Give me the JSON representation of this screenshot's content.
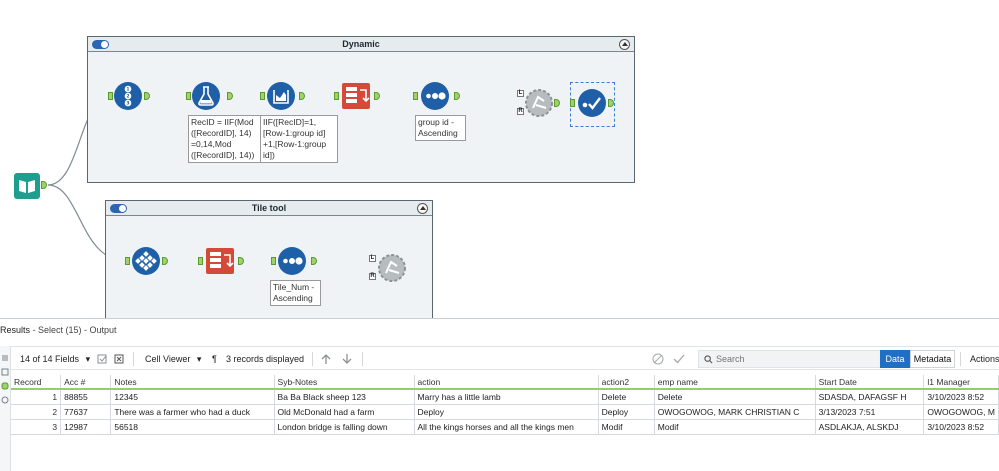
{
  "containers": {
    "dynamic": {
      "title": "Dynamic"
    },
    "tile": {
      "title": "Tile tool"
    }
  },
  "annotations": {
    "formula_recid": "RecID = IIF(Mod\n([RecordID], 14)\n=0,14,Mod\n([RecordID], 14))",
    "multirow": "IIF([RecID]=1,\n[Row-1:group id]\n+1,[Row-1:group\nid])",
    "sort_group": "group id -\nAscending",
    "sort_tile": "Tile_Num -\nAscending"
  },
  "anchors": {
    "join_l": "L",
    "join_r": "R"
  },
  "icons": {
    "input": "book-input-icon",
    "record_id": "record-id-icon",
    "formula": "formula-flask-icon",
    "multirow": "multi-row-formula-icon",
    "crosstab": "cross-tab-icon",
    "sort": "sort-dots-icon",
    "join": "join-gear-icon",
    "select": "select-check-icon",
    "tile": "tile-icon"
  },
  "colors": {
    "tool_blue": "#1f5fa8",
    "tool_teal": "#1e9e8e",
    "tool_red": "#d44a3a",
    "anchor_green": "#9ed36a",
    "accent": "#1f6fc5"
  },
  "results": {
    "label": "Results",
    "context": " - Select (15) - Output",
    "fields_selector": "14 of 14 Fields",
    "cell_viewer": "Cell Viewer",
    "records_displayed": "3 records displayed",
    "search_placeholder": "Search",
    "data_btn": "Data",
    "metadata_btn": "Metadata",
    "actions_btn": "Actions",
    "columns": [
      "Record",
      "Acc #",
      "Notes",
      "Syb-Notes",
      "action",
      "action2",
      "emp name",
      "Start Date",
      "l1 Manager"
    ],
    "rows": [
      [
        "1",
        "88855",
        "12345",
        "Ba Ba Black sheep 123",
        "Marry has a little lamb",
        "Delete",
        "Delete",
        "SDASDA, DAFAGSF H",
        "3/10/2023 8:52"
      ],
      [
        "2",
        "77637",
        "There was a farmer who had a duck",
        "Old McDonald had a farm",
        "Deploy",
        "Deploy",
        "OWOGOWOG, MARK CHRISTIAN C",
        "3/13/2023 7:51",
        "OWOGOWOG, M"
      ],
      [
        "3",
        "12987",
        "56518",
        "London bridge is falling down",
        "All the kings horses and all the kings men",
        "Modif",
        "Modif",
        "ASDLAKJA, ALSKDJ",
        "3/10/2023 8:52"
      ]
    ]
  }
}
